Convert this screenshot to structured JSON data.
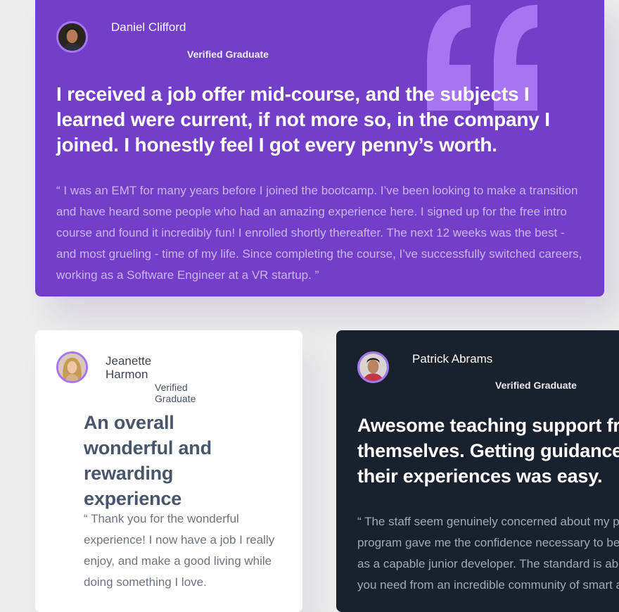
{
  "colors": {
    "page_background": "#ededed",
    "violet_card": "#733fc8",
    "white_card": "#ffffff",
    "dark_card": "#19212e",
    "quote_mark": "#a775f1",
    "avatar_border": "#a775f1"
  },
  "testimonials": [
    {
      "name": "Daniel Clifford",
      "badge": "Verified Graduate",
      "headline": "I received a job offer mid-course, and the subjects I learned were current, if not more so, in the company I joined. I honestly feel I got every penny’s worth.",
      "body": "“ I was an EMT for many years before I joined the bootcamp. I’ve been looking to make a transition and have heard some people who had an amazing experience here. I signed up for the free intro course and found it incredibly fun! I enrolled shortly thereafter. The next 12 weeks was the best - and most grueling - time of my life. Since completing the course, I’ve successfully switched careers, working as a Software Engineer at a VR startup. ”"
    },
    {
      "name": "Jeanette Harmon",
      "badge": "Verified Graduate",
      "headline": "An overall wonderful and rewarding experience",
      "body": "“ Thank you for the wonderful experience! I now have a job I really enjoy, and make a good living while doing something I love."
    },
    {
      "name": "Patrick Abrams",
      "badge": "Verified Graduate",
      "headline_lines": [
        "Awesome teaching support from TAs who did the bootcamp",
        "themselves. Getting guidance from them and learning from",
        "their experiences was easy."
      ],
      "body_lines": [
        "“ The staff seem genuinely concerned about my progress which I find really refreshing. The",
        "program gave me the confidence necessary to be able to go out in the world and present myself",
        "as a capable junior developer. The standard is above the rest. You will get the personal attention",
        "you need from an incredible community of smart and amazing people. ”"
      ]
    }
  ]
}
